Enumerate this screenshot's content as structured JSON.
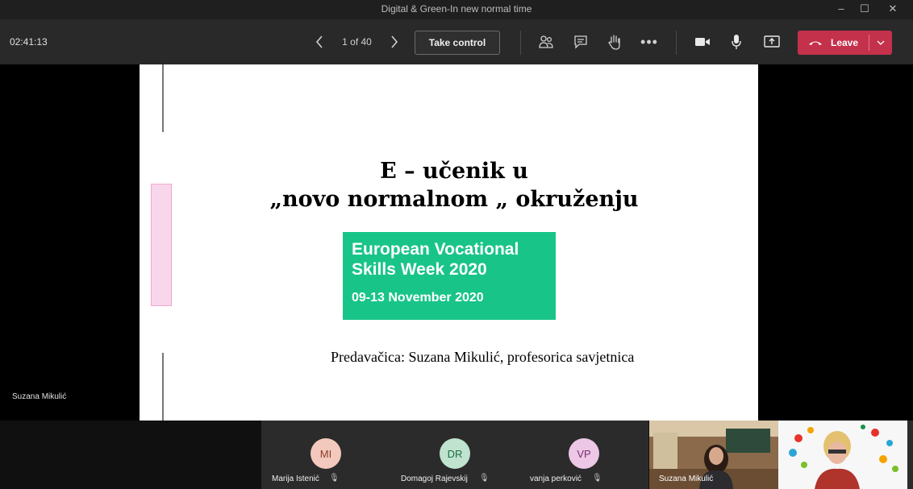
{
  "window": {
    "title": "Digital & Green-In new normal time"
  },
  "toolbar": {
    "timer": "02:41:13",
    "page_counter": "1 of 40",
    "take_control_label": "Take control",
    "leave_label": "Leave"
  },
  "slide": {
    "title_line1": "E – učenik u",
    "title_line2": "„novo normalnom „ okruženju",
    "badge_line1": "European Vocational",
    "badge_line2": "Skills Week 2020",
    "badge_dates": "09-13 November 2020",
    "presenter": "Predavačica: Suzana Mikulić, profesorica savjetnica",
    "badge_color": "#19c489"
  },
  "stage": {
    "presenter_name": "Suzana Mikulić"
  },
  "participants": [
    {
      "initials": "MI",
      "name": "Marija Istenić"
    },
    {
      "initials": "DR",
      "name": "Domagoj Rajevskij"
    },
    {
      "initials": "VP",
      "name": "vanja perković"
    }
  ],
  "video_tiles": [
    {
      "name": "Suzana Mikulić"
    }
  ],
  "colors": {
    "leave": "#c4314b",
    "toolbar": "#292929"
  }
}
